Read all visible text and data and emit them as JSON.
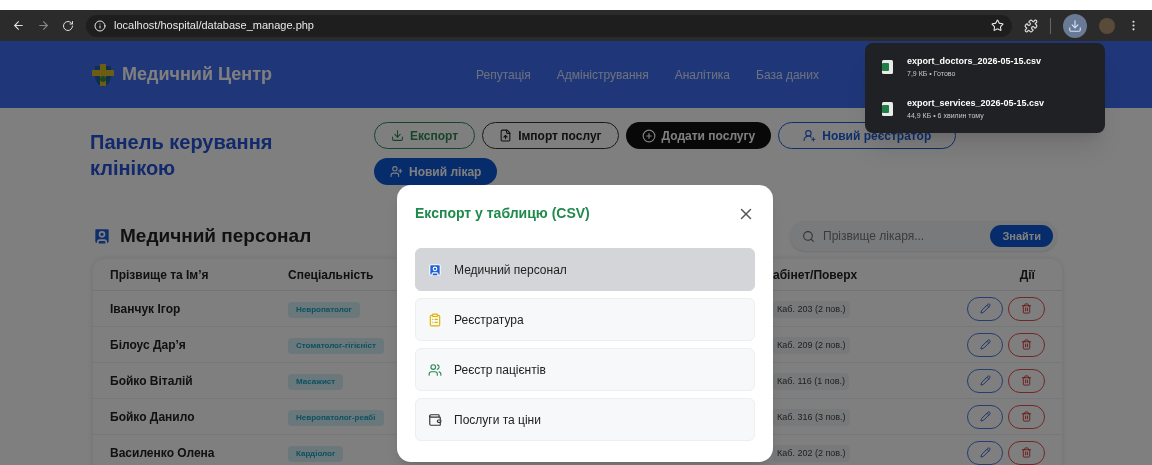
{
  "browser": {
    "url": "localhost/hospital/database_manage.php",
    "downloads_open": true
  },
  "downloads": [
    {
      "file": "export_doctors_2026-05-15.csv",
      "detail": "7,9 КБ • Готово"
    },
    {
      "file": "export_services_2026-05-15.csv",
      "detail": "44,9 КБ • 6 хвилин тому"
    }
  ],
  "header": {
    "brand": "Медичний Центр",
    "nav": [
      "Репутація",
      "Адміністрування",
      "Аналітика",
      "База даних"
    ]
  },
  "page_title": "Панель керування клінікою",
  "actions": [
    {
      "label": "Експорт",
      "kind": "export"
    },
    {
      "label": "Імпорт послуг",
      "kind": "import"
    },
    {
      "label": "Додати послугу",
      "kind": "add"
    },
    {
      "label": "Новий реєстратор",
      "kind": "registrar"
    },
    {
      "label": "Новий лікар",
      "kind": "doctor"
    }
  ],
  "section": {
    "title": "Медичний персонал",
    "search_placeholder": "Прізвище лікаря...",
    "search_button": "Знайти"
  },
  "table": {
    "columns": [
      "Прізвище та Ім’я",
      "Спеціальність",
      "абінет/Поверх",
      "Дії"
    ],
    "rows": [
      {
        "name": "Іванчук Ігор",
        "specialty": "Невропатолог",
        "room": "Каб. 203 (2 пов.)"
      },
      {
        "name": "Білоус Дар’я",
        "specialty": "Стоматолог-гігієніст",
        "room": "Каб. 209 (2 пов.)"
      },
      {
        "name": "Бойко Віталій",
        "specialty": "Масажист",
        "room": "Каб. 116 (1 пов.)"
      },
      {
        "name": "Бойко Данило",
        "specialty": "Невропатолог-реабі",
        "room": "Каб. 316 (3 пов.)"
      },
      {
        "name": "Василенко Олена",
        "specialty": "Кардіолог",
        "room": "Каб. 202 (2 пов.)"
      }
    ]
  },
  "modal": {
    "title": "Експорт у таблицю (CSV)",
    "options": [
      {
        "label": "Медичний персонал",
        "kind": "staff",
        "selected": true
      },
      {
        "label": "Реєстратура",
        "kind": "reception",
        "selected": false
      },
      {
        "label": "Реєстр пацієнтів",
        "kind": "patients",
        "selected": false
      },
      {
        "label": "Послуги та ціни",
        "kind": "services",
        "selected": false
      }
    ]
  }
}
